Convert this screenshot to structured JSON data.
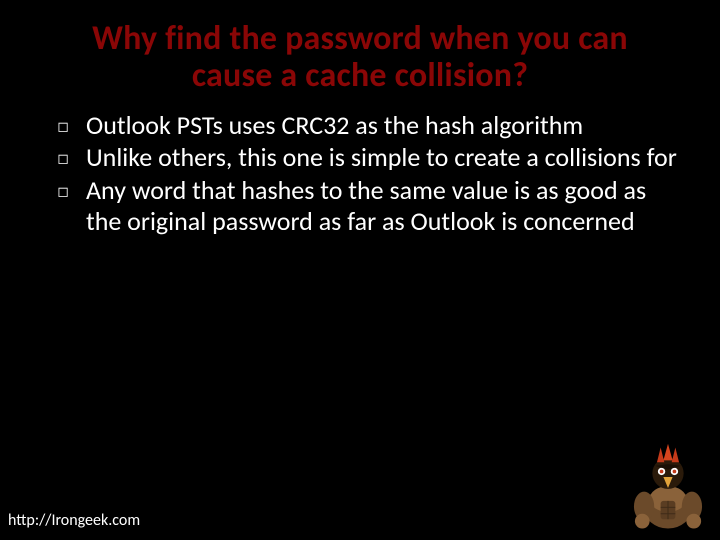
{
  "title": "Why find the password when you can cause a cache collision?",
  "bullets": [
    "Outlook PSTs uses CRC32 as the hash algorithm",
    "Unlike others, this one is simple to create a collisions for",
    "Any word that hashes to the same value is as good as the original password as far as Outlook is concerned"
  ],
  "footer": "http://Irongeek.com"
}
